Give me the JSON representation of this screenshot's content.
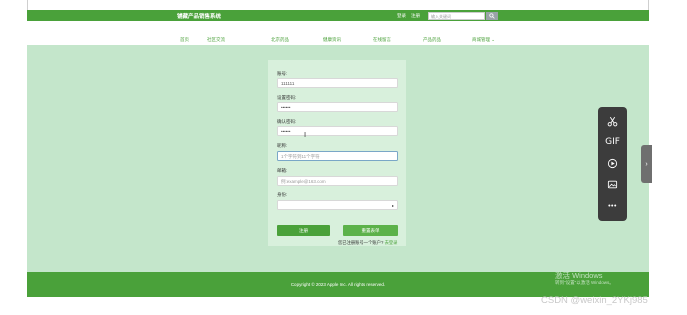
{
  "header": {
    "site_title": "铺藏产品销售系统",
    "login_link": "登录",
    "register_link": "注册",
    "search_placeholder": "输入关键词"
  },
  "nav": {
    "items": [
      {
        "label": "首页"
      },
      {
        "label": "社区交流"
      },
      {
        "label": "北京药品"
      },
      {
        "label": "健康资讯"
      },
      {
        "label": "在线留言"
      },
      {
        "label": "产品药品"
      },
      {
        "label": "商城管理",
        "has_dropdown": true
      }
    ]
  },
  "form": {
    "fields": [
      {
        "label": "账号:",
        "value": "111111",
        "type": "text"
      },
      {
        "label": "设置密码:",
        "value": "••••••",
        "type": "password"
      },
      {
        "label": "确认密码:",
        "value": "••••••",
        "type": "password"
      },
      {
        "label": "昵称:",
        "placeholder": "1个字符到11个字符",
        "type": "text",
        "focused": true
      },
      {
        "label": "邮箱:",
        "placeholder": "例:example@163.com",
        "type": "email"
      },
      {
        "label": "身份:",
        "value": "",
        "type": "select"
      }
    ],
    "register_button": "注册",
    "reset_button": "重置表单",
    "login_hint": "您已注册账号一个账户?",
    "login_link": "去登录"
  },
  "footer": {
    "copyright": "Copyright © 2023 Apple Inc. All rights reserved."
  },
  "toolbar": {
    "tools": [
      "scissors-icon",
      "gif-icon",
      "record-icon",
      "image-icon",
      "more-icon"
    ],
    "gif_label": "GIF",
    "more_label": "•••",
    "side_tab_label": "›"
  },
  "watermark": {
    "line1": "激活 Windows",
    "line2": "转到\"设置\"以激活 Windows。",
    "csdn": "CSDN @weixin_2YKj985"
  },
  "colors": {
    "brand_green": "#4aa13a",
    "page_background": "#c4e6cb",
    "card_background": "#d8f0dc",
    "toolbar_dark": "#3c3c3c"
  }
}
